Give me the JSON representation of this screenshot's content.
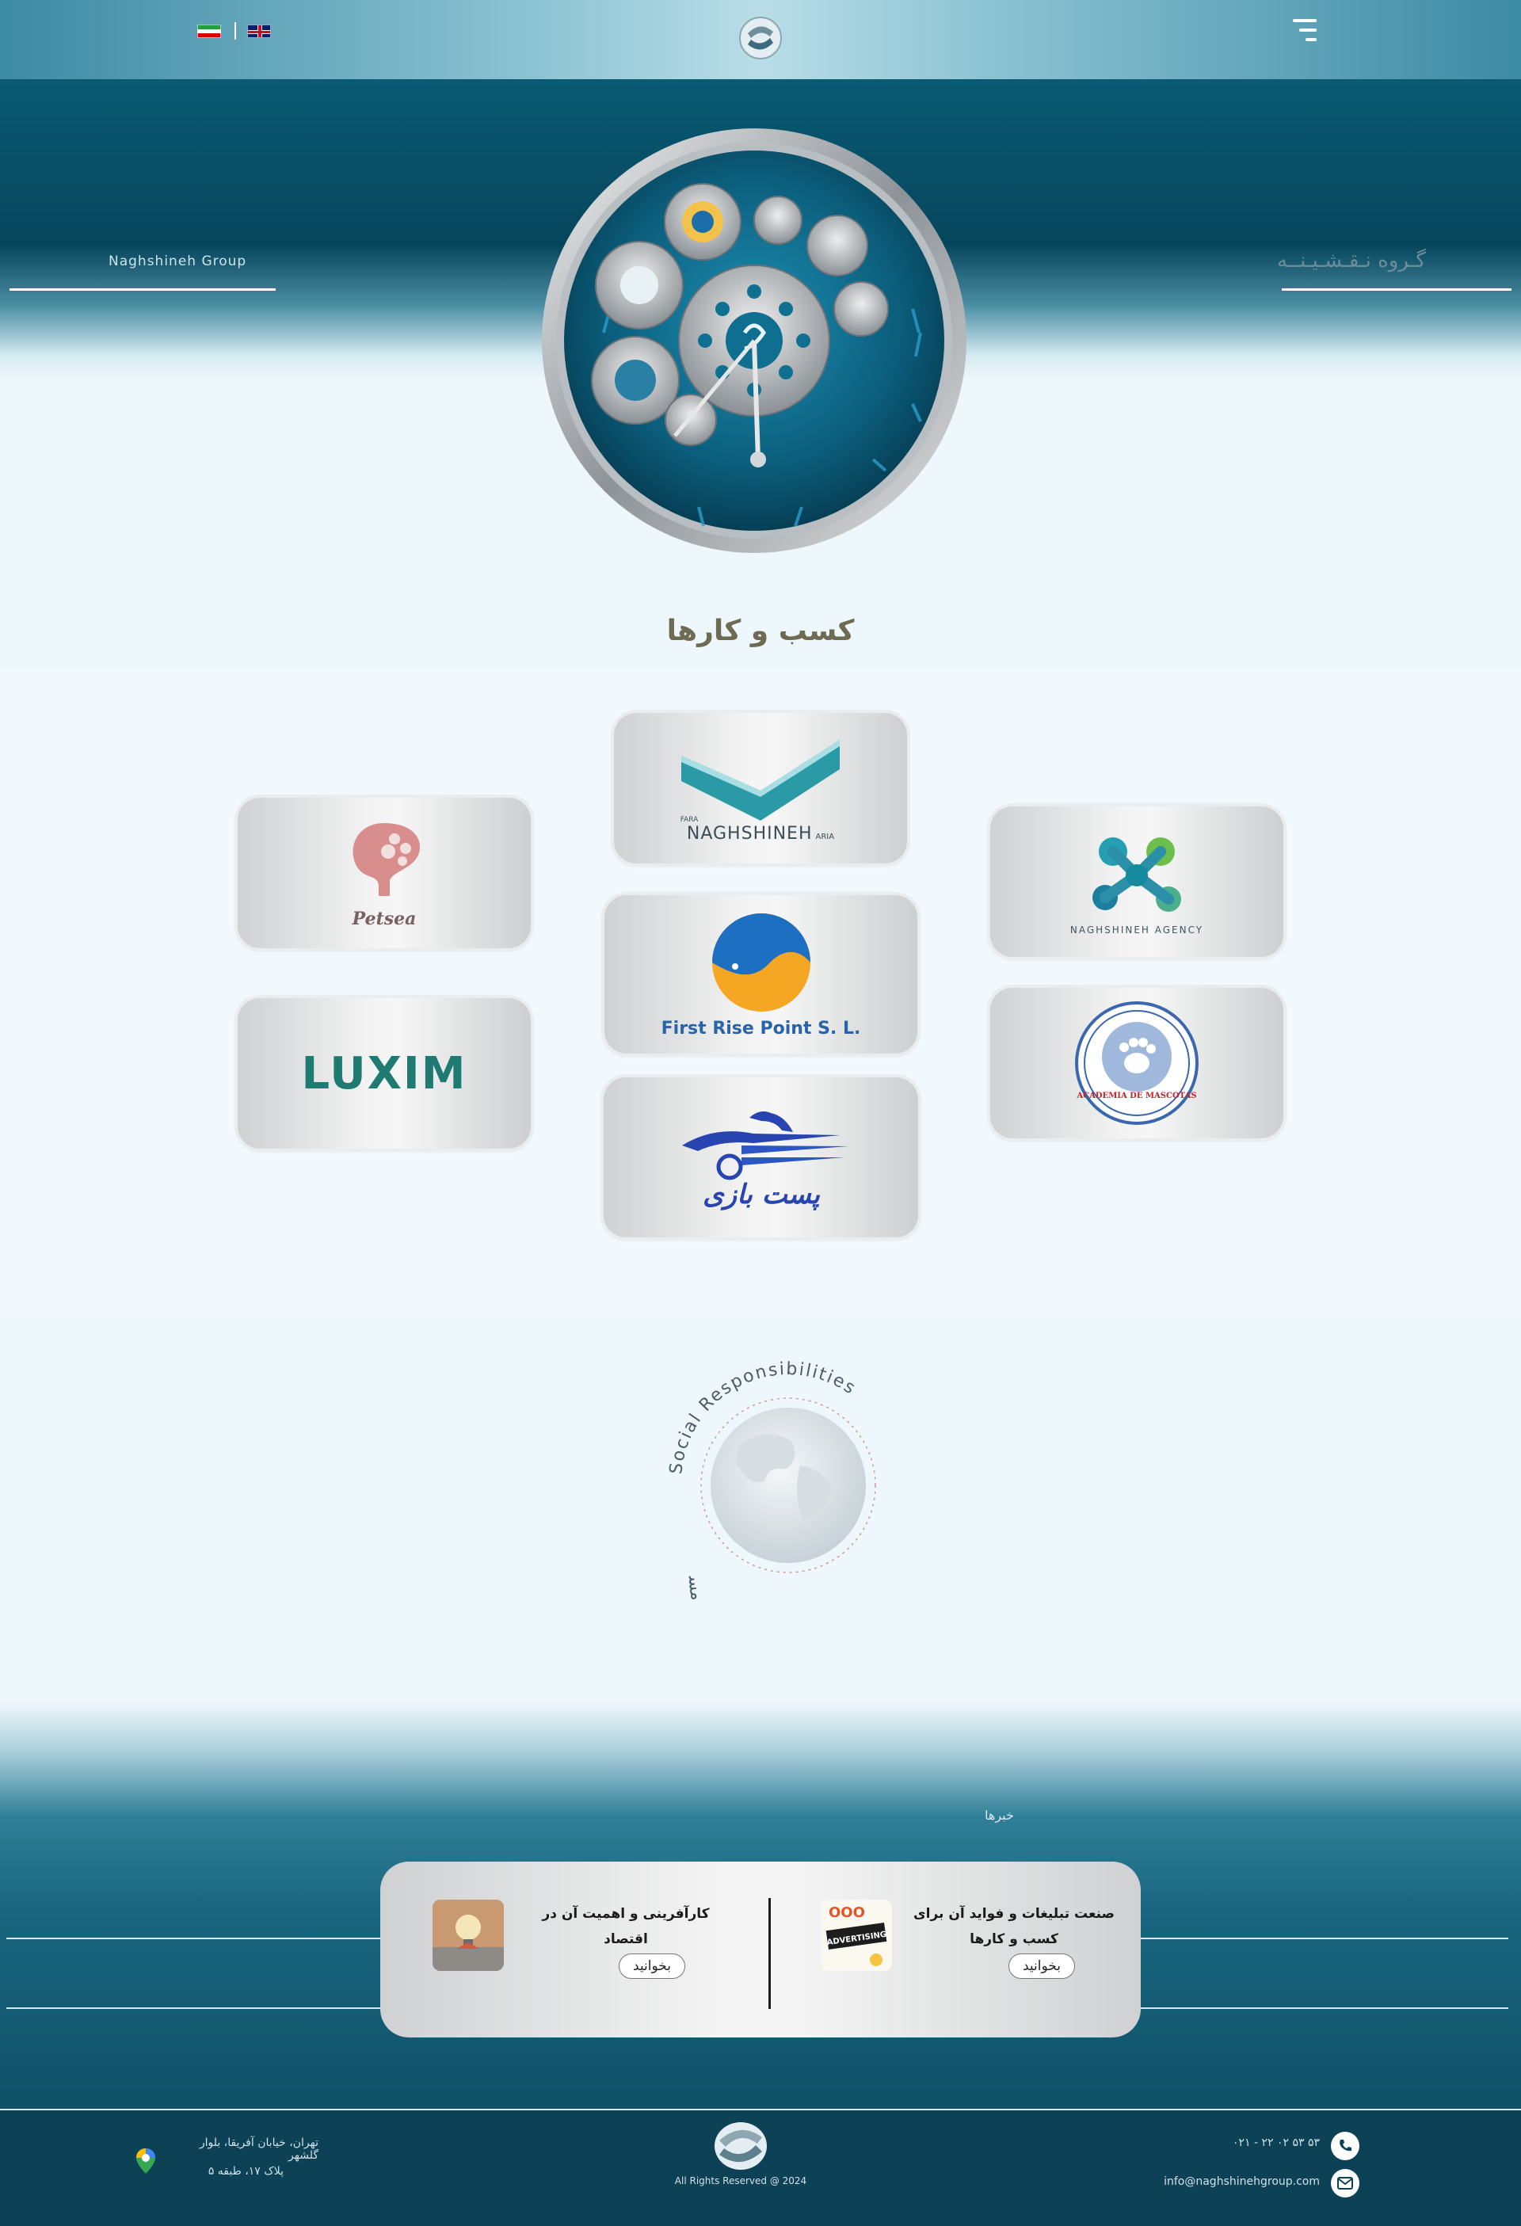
{
  "header": {
    "languages": [
      {
        "code": "fa",
        "flag": "iran-flag-icon"
      },
      {
        "code": "en",
        "flag": "uk-flag-icon"
      }
    ],
    "logo": "naghshineh-logo",
    "menu_icon": "hamburger-menu-icon"
  },
  "hero": {
    "title_en": "Naghshineh Group",
    "title_fa": "گـروه نـقـشـیـنــه"
  },
  "businesses": {
    "title": "کسب و کارها",
    "items": [
      {
        "name": "Petsea",
        "text": "Petsea"
      },
      {
        "name": "Fara Naghshineh Aria",
        "text_top": "FARA",
        "text_main": "NAGHSHINEH",
        "text_sub": "ARIA"
      },
      {
        "name": "Naghshineh Agency",
        "text": "NAGHSHINEH AGENCY"
      },
      {
        "name": "Luxim",
        "text": "LUXIM"
      },
      {
        "name": "First Rise Point S. L.",
        "text": "First Rise Point S. L."
      },
      {
        "name": "Academia de Mascotas",
        "text": "ACADEMIA DE MASCOTAS"
      },
      {
        "name": "Post Bazi",
        "text": "پست بازی"
      }
    ]
  },
  "social": {
    "arc_text_en": "Social Responsibilities",
    "arc_text_fa": "مسئولیت های اجتماعی"
  },
  "news": {
    "label": "خبرها",
    "items": [
      {
        "title_line1": "صنعت تبلیغات و فواید آن برای",
        "title_line2": "کسب و کارها",
        "button": "بخوانید",
        "thumb": "advertising"
      },
      {
        "title_line1": "کارآفرینی و اهمیت آن در اقتصاد",
        "title_line2": "",
        "button": "بخوانید",
        "thumb": "entrepreneurship"
      }
    ]
  },
  "footer": {
    "phone": "۰۲۱ - ۲۲ ۰۲ ۵۳ ۵۳",
    "email": "info@naghshinehgroup.com",
    "copyright": "All Rights Reserved @ 2024",
    "address_line1": "تهران، خیابان آفریقا، بلوار گلشهر",
    "address_line2": "پلاک ۱۷، طبقه ۵"
  }
}
